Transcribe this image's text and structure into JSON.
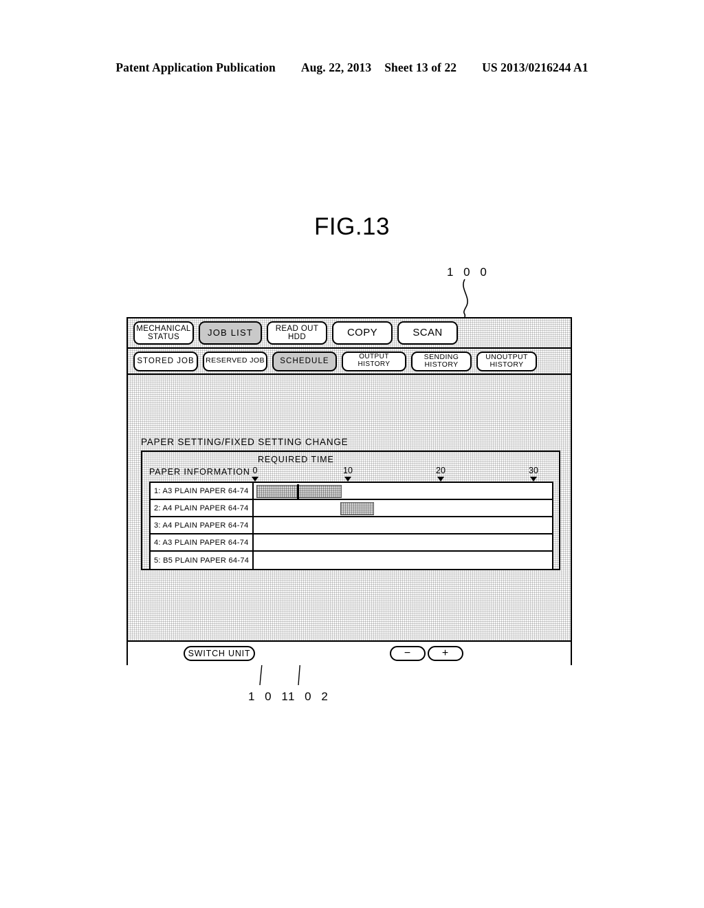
{
  "page_header": {
    "publication": "Patent Application Publication",
    "date": "Aug. 22, 2013",
    "sheet": "Sheet 13 of 22",
    "patent_number": "US 2013/0216244 A1"
  },
  "figure": {
    "label": "FIG.13",
    "reference_numerals": {
      "panel": "1 0 0",
      "bar_left": "1 0 1",
      "bar_divider": "1 0 2"
    }
  },
  "panel": {
    "tabs_row1": [
      {
        "label": "MECHANICAL\nSTATUS",
        "selected": false,
        "name": "tab-mechanical-status"
      },
      {
        "label": "JOB LIST",
        "selected": true,
        "name": "tab-job-list"
      },
      {
        "label": "READ OUT\nHDD",
        "selected": false,
        "name": "tab-read-out-hdd"
      },
      {
        "label": "COPY",
        "selected": false,
        "name": "tab-copy"
      },
      {
        "label": "SCAN",
        "selected": false,
        "name": "tab-scan"
      }
    ],
    "tabs_row2": [
      {
        "label": "STORED JOB",
        "selected": false,
        "name": "tab-stored-job"
      },
      {
        "label": "RESERVED JOB",
        "selected": false,
        "name": "tab-reserved-job"
      },
      {
        "label": "SCHEDULE",
        "selected": true,
        "name": "tab-schedule"
      },
      {
        "label": "OUTPUT HISTORY",
        "selected": false,
        "name": "tab-output-history"
      },
      {
        "label": "SENDING\nHISTORY",
        "selected": false,
        "name": "tab-sending-history"
      },
      {
        "label": "UNOUTPUT\nHISTORY",
        "selected": false,
        "name": "tab-unoutput-history"
      }
    ],
    "content_title": "PAPER SETTING/FIXED SETTING CHANGE",
    "column_header_paper": "PAPER INFORMATION",
    "axis_title": "REQUIRED TIME",
    "bottom_bar": {
      "switch_unit": "SWITCH UNIT",
      "minus": "−",
      "plus": "+"
    }
  },
  "chart_data": {
    "type": "bar",
    "title": "PAPER SETTING/FIXED SETTING CHANGE",
    "xlabel": "REQUIRED TIME",
    "ylabel": "PAPER INFORMATION",
    "xlim": [
      0,
      32
    ],
    "ticks": [
      0,
      10,
      20,
      30
    ],
    "tick_labels": [
      "0",
      "10",
      "20",
      "30"
    ],
    "grid": false,
    "legend": "none",
    "orientation": "horizontal",
    "categories": [
      "1: A3 PLAIN PAPER 64-74",
      "2: A4 PLAIN PAPER 64-74",
      "3: A4 PLAIN PAPER 64-74",
      "4: A3 PLAIN PAPER 64-74",
      "5: B5 PLAIN PAPER 64-74"
    ],
    "bars": [
      {
        "row": 0,
        "start": 0.3,
        "end": 9.5,
        "divider_at": 4.7,
        "shaded": true
      },
      {
        "row": 1,
        "start": 9.3,
        "end": 13.0,
        "divider_at": null,
        "shaded": true
      },
      {
        "row": 2,
        "start": null,
        "end": null,
        "divider_at": null,
        "shaded": false
      },
      {
        "row": 3,
        "start": null,
        "end": null,
        "divider_at": null,
        "shaded": false
      },
      {
        "row": 4,
        "start": null,
        "end": null,
        "divider_at": null,
        "shaded": false
      }
    ]
  },
  "colors": {
    "selected_tab": "#c9c9c9",
    "bar_fill": "#dddddd",
    "panel_background": "#fbfbfb",
    "line": "#000000"
  }
}
